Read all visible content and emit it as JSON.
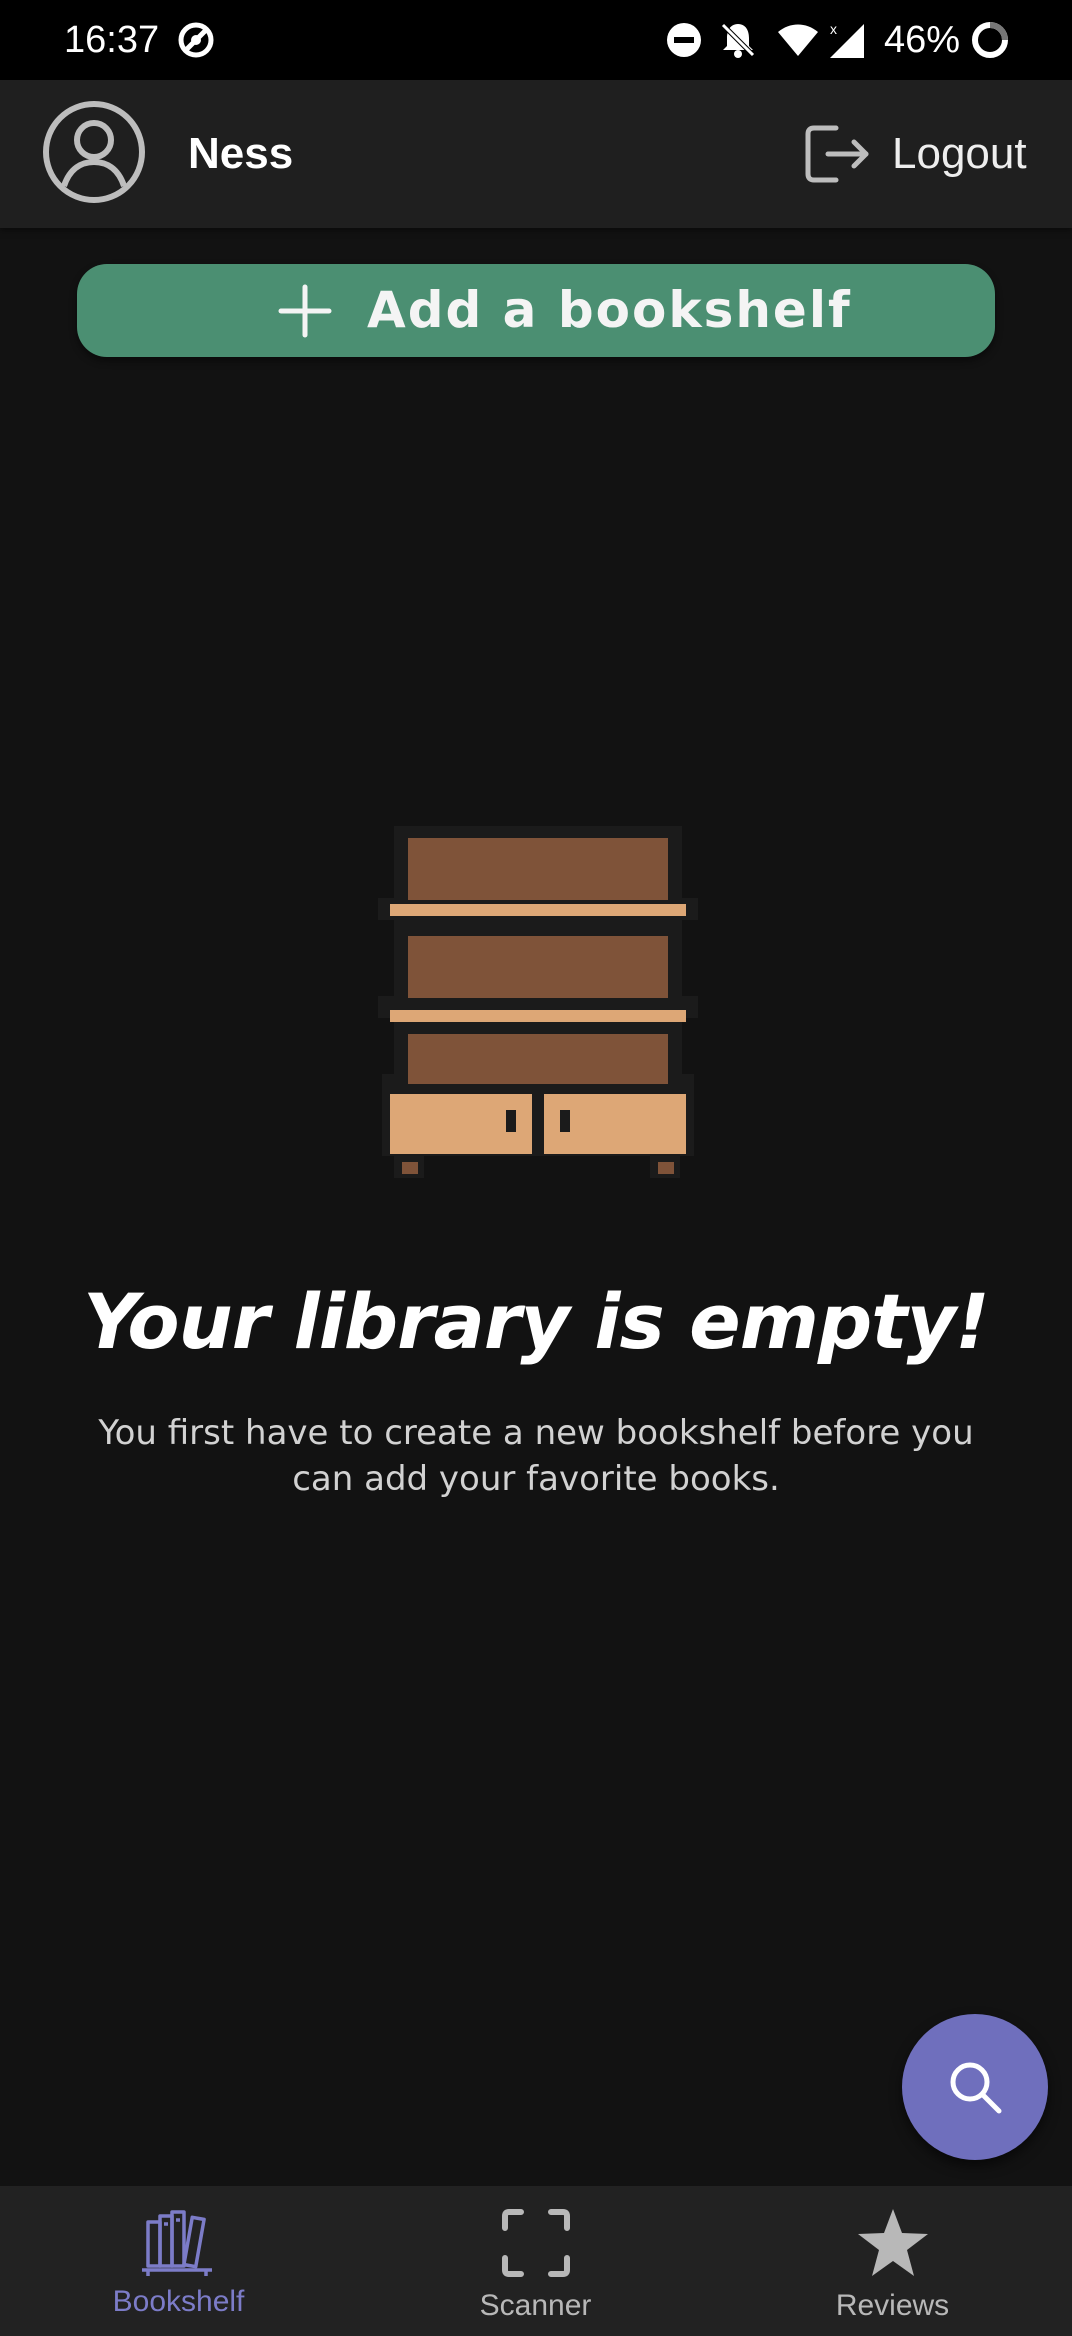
{
  "status_bar": {
    "time": "16:37",
    "battery": "46%",
    "icons": [
      "vpn-icon",
      "dnd-icon",
      "bell-off-icon",
      "wifi-icon",
      "signal-icon",
      "battery-ring-icon"
    ]
  },
  "header": {
    "user_name": "Ness",
    "logout_label": "Logout"
  },
  "actions": {
    "add_bookshelf_label": "Add a bookshelf"
  },
  "empty_state": {
    "title": "Your library is empty!",
    "description": "You first have to create a new bookshelf before you can add your favorite books."
  },
  "bottom_nav": {
    "items": [
      {
        "label": "Bookshelf",
        "icon": "books-icon",
        "active": true
      },
      {
        "label": "Scanner",
        "icon": "scan-frame-icon",
        "active": false
      },
      {
        "label": "Reviews",
        "icon": "star-icon",
        "active": false
      }
    ]
  },
  "colors": {
    "background": "#121212",
    "app_bar": "#1f1f1f",
    "primary_green": "#4b8f72",
    "accent_purple": "#6f6fbd",
    "shelf_dark": "#7f5339",
    "shelf_light": "#dda776"
  }
}
